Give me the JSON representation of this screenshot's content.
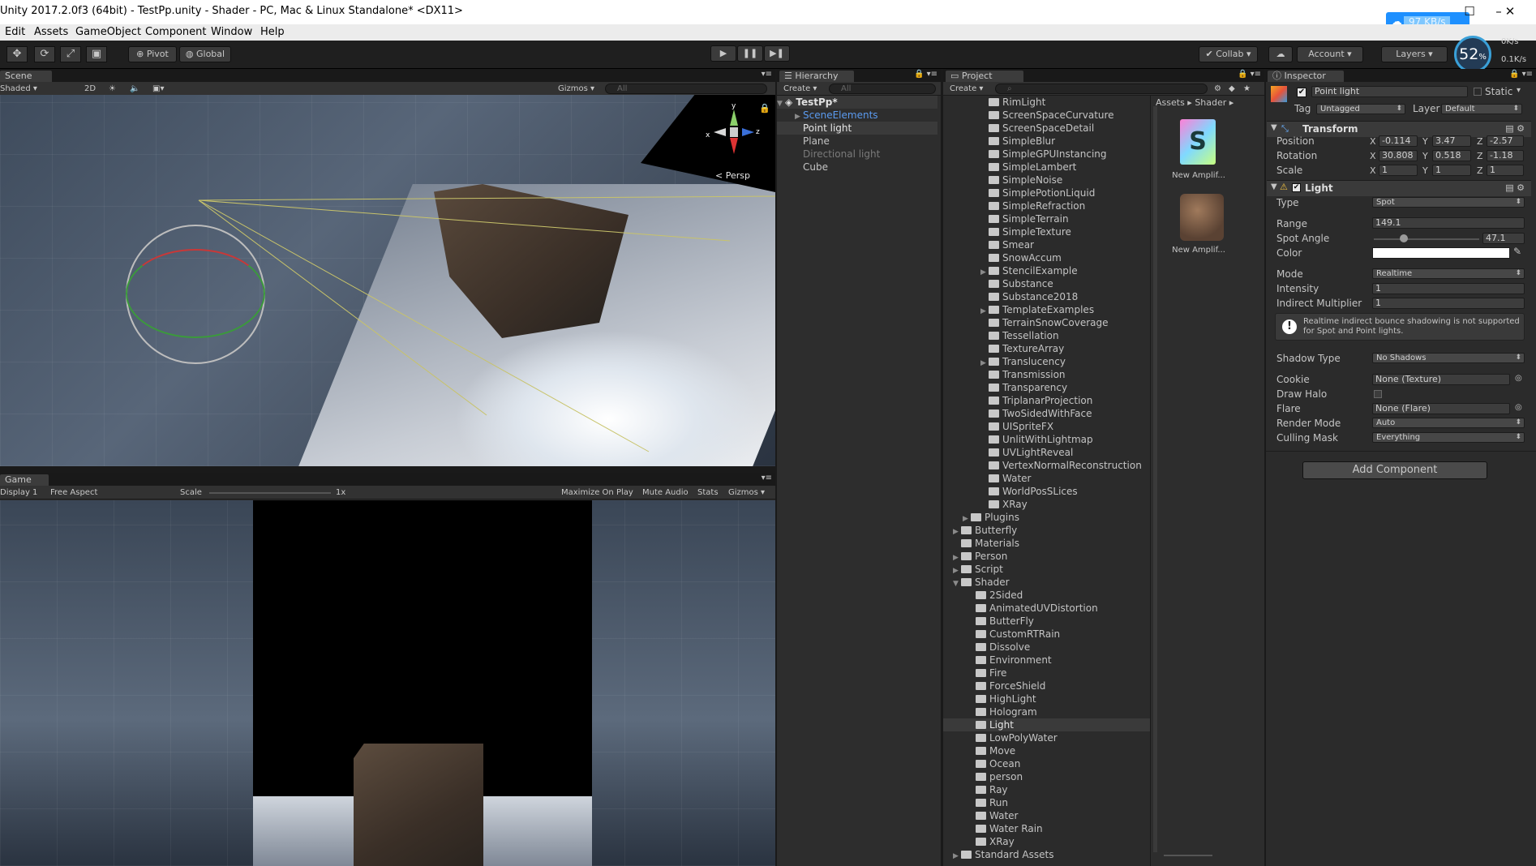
{
  "titlebar": {
    "title": "Unity 2017.2.0f3 (64bit) - TestPp.unity - Shader - PC, Mac & Linux Standalone* <DX11>",
    "net_rate": "97 KB/s"
  },
  "menu": [
    "Edit",
    "Assets",
    "GameObject",
    "Component",
    "Window",
    "Help"
  ],
  "toolbar": {
    "pivot": "Pivot",
    "global": "Global",
    "collab": "Collab",
    "account": "Account",
    "layers": "Layers",
    "gauge": "52",
    "gauge_unit": "%",
    "speed_up": "0K/s",
    "speed_down": "0.1K/s"
  },
  "scene": {
    "tab": "Scene",
    "shaded": "Shaded",
    "mode_2d": "2D",
    "gizmos": "Gizmos",
    "search_placeholder": "All",
    "persp": "Persp",
    "axis_y": "y",
    "axis_x": "x",
    "axis_z": "z"
  },
  "game": {
    "tab": "Game",
    "display": "Display 1",
    "aspect": "Free Aspect",
    "scale_label": "Scale",
    "scale_value": "1x",
    "maximize": "Maximize On Play",
    "mute": "Mute Audio",
    "stats": "Stats",
    "gizmos": "Gizmos"
  },
  "hierarchy": {
    "tab": "Hierarchy",
    "create": "Create",
    "search_placeholder": "All",
    "scene_name": "TestPp*",
    "items": [
      "SceneElements",
      "Point light",
      "Plane",
      "Directional light",
      "Cube"
    ]
  },
  "project": {
    "tab": "Project",
    "create": "Create",
    "breadcrumb": [
      "Assets",
      "Shader"
    ],
    "assets": [
      "New Amplif...",
      "New Amplif..."
    ],
    "tree_nested": [
      "RimLight",
      "ScreenSpaceCurvature",
      "ScreenSpaceDetail",
      "SimpleBlur",
      "SimpleGPUInstancing",
      "SimpleLambert",
      "SimpleNoise",
      "SimplePotionLiquid",
      "SimpleRefraction",
      "SimpleTerrain",
      "SimpleTexture",
      "Smear",
      "SnowAccum",
      "StencilExample",
      "Substance",
      "Substance2018",
      "TemplateExamples",
      "TerrainSnowCoverage",
      "Tessellation",
      "TextureArray",
      "Translucency",
      "Transmission",
      "Transparency",
      "TriplanarProjection",
      "TwoSidedWithFace",
      "UISpriteFX",
      "UnlitWithLightmap",
      "UVLightReveal",
      "VertexNormalReconstruction",
      "Water",
      "WorldPosSLices",
      "XRay"
    ],
    "plugins": "Plugins",
    "top_folders": [
      "Butterfly",
      "Materials",
      "Person",
      "Script",
      "Shader"
    ],
    "shader_children": [
      "2Sided",
      "AnimatedUVDistortion",
      "ButterFly",
      "CustomRTRain",
      "Dissolve",
      "Environment",
      "Fire",
      "ForceShield",
      "HighLight",
      "Hologram",
      "Light",
      "LowPolyWater",
      "Move",
      "Ocean",
      "person",
      "Ray",
      "Run",
      "Water",
      "Water Rain",
      "XRay"
    ],
    "standard_assets": "Standard Assets",
    "selected": "Light"
  },
  "inspector": {
    "tab": "Inspector",
    "object_name": "Point light",
    "static_label": "Static",
    "tag_label": "Tag",
    "tag_value": "Untagged",
    "layer_label": "Layer",
    "layer_value": "Default",
    "transform": {
      "title": "Transform",
      "position_label": "Position",
      "position": [
        "-0.114",
        "3.47",
        "-2.57"
      ],
      "rotation_label": "Rotation",
      "rotation": [
        "30.808",
        "0.518",
        "-1.18"
      ],
      "scale_label": "Scale",
      "scale": [
        "1",
        "1",
        "1"
      ]
    },
    "light": {
      "title": "Light",
      "type_label": "Type",
      "type_value": "Spot",
      "range_label": "Range",
      "range_value": "149.1",
      "spot_angle_label": "Spot Angle",
      "spot_angle_value": "47.1",
      "color_label": "Color",
      "color_value": "#ffffff",
      "mode_label": "Mode",
      "mode_value": "Realtime",
      "intensity_label": "Intensity",
      "intensity_value": "1",
      "indirect_label": "Indirect Multiplier",
      "indirect_value": "1",
      "warning": "Realtime indirect bounce shadowing is not supported for Spot and Point lights.",
      "shadow_label": "Shadow Type",
      "shadow_value": "No Shadows",
      "cookie_label": "Cookie",
      "cookie_value": "None (Texture)",
      "halo_label": "Draw Halo",
      "flare_label": "Flare",
      "flare_value": "None (Flare)",
      "render_label": "Render Mode",
      "render_value": "Auto",
      "culling_label": "Culling Mask",
      "culling_value": "Everything"
    },
    "add_component": "Add Component"
  },
  "colors": {
    "accent": "#3a72b0",
    "selection": "#3e5f96",
    "panel": "#2d2d2d"
  }
}
